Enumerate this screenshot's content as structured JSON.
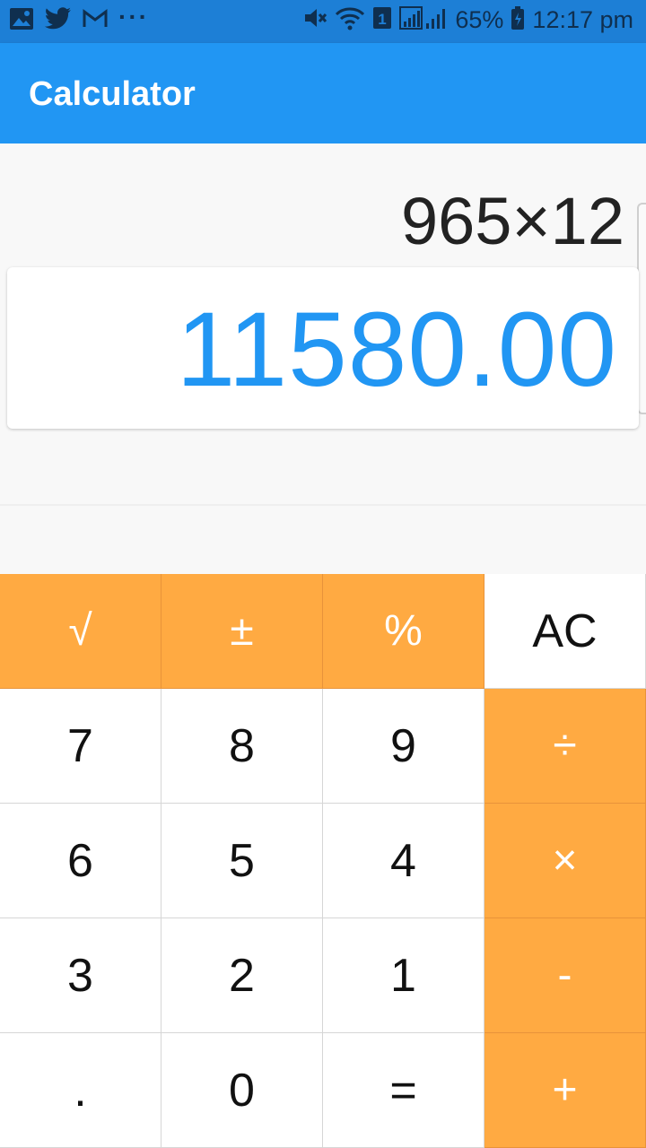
{
  "status_bar": {
    "left_icons": [
      "gallery-icon",
      "twitter-icon",
      "gmail-icon",
      "more-dots-icon"
    ],
    "right_icons": [
      "mute-icon",
      "wifi-icon",
      "sim-1-icon",
      "signal-icon",
      "battery-icon"
    ],
    "dots": "···",
    "sim_number": "1",
    "battery": "65%",
    "time": "12:17 pm"
  },
  "app_bar": {
    "title": "Calculator"
  },
  "display": {
    "expression": "965×12",
    "result": "11580.00"
  },
  "keypad": {
    "sqrt": "√",
    "plus_minus": "±",
    "percent": "%",
    "ac": "AC",
    "seven": "7",
    "eight": "8",
    "nine": "9",
    "divide": "÷",
    "six": "6",
    "five": "5",
    "four": "4",
    "multiply": "×",
    "three": "3",
    "two": "2",
    "one": "1",
    "minus": "-",
    "dot": ".",
    "zero": "0",
    "equals": "=",
    "plus": "+"
  },
  "colors": {
    "status_bar": "#1d7fd6",
    "app_bar": "#2196f3",
    "result_text": "#2196f3",
    "operator_key": "#ffaa42",
    "digit_key": "#ffffff"
  }
}
